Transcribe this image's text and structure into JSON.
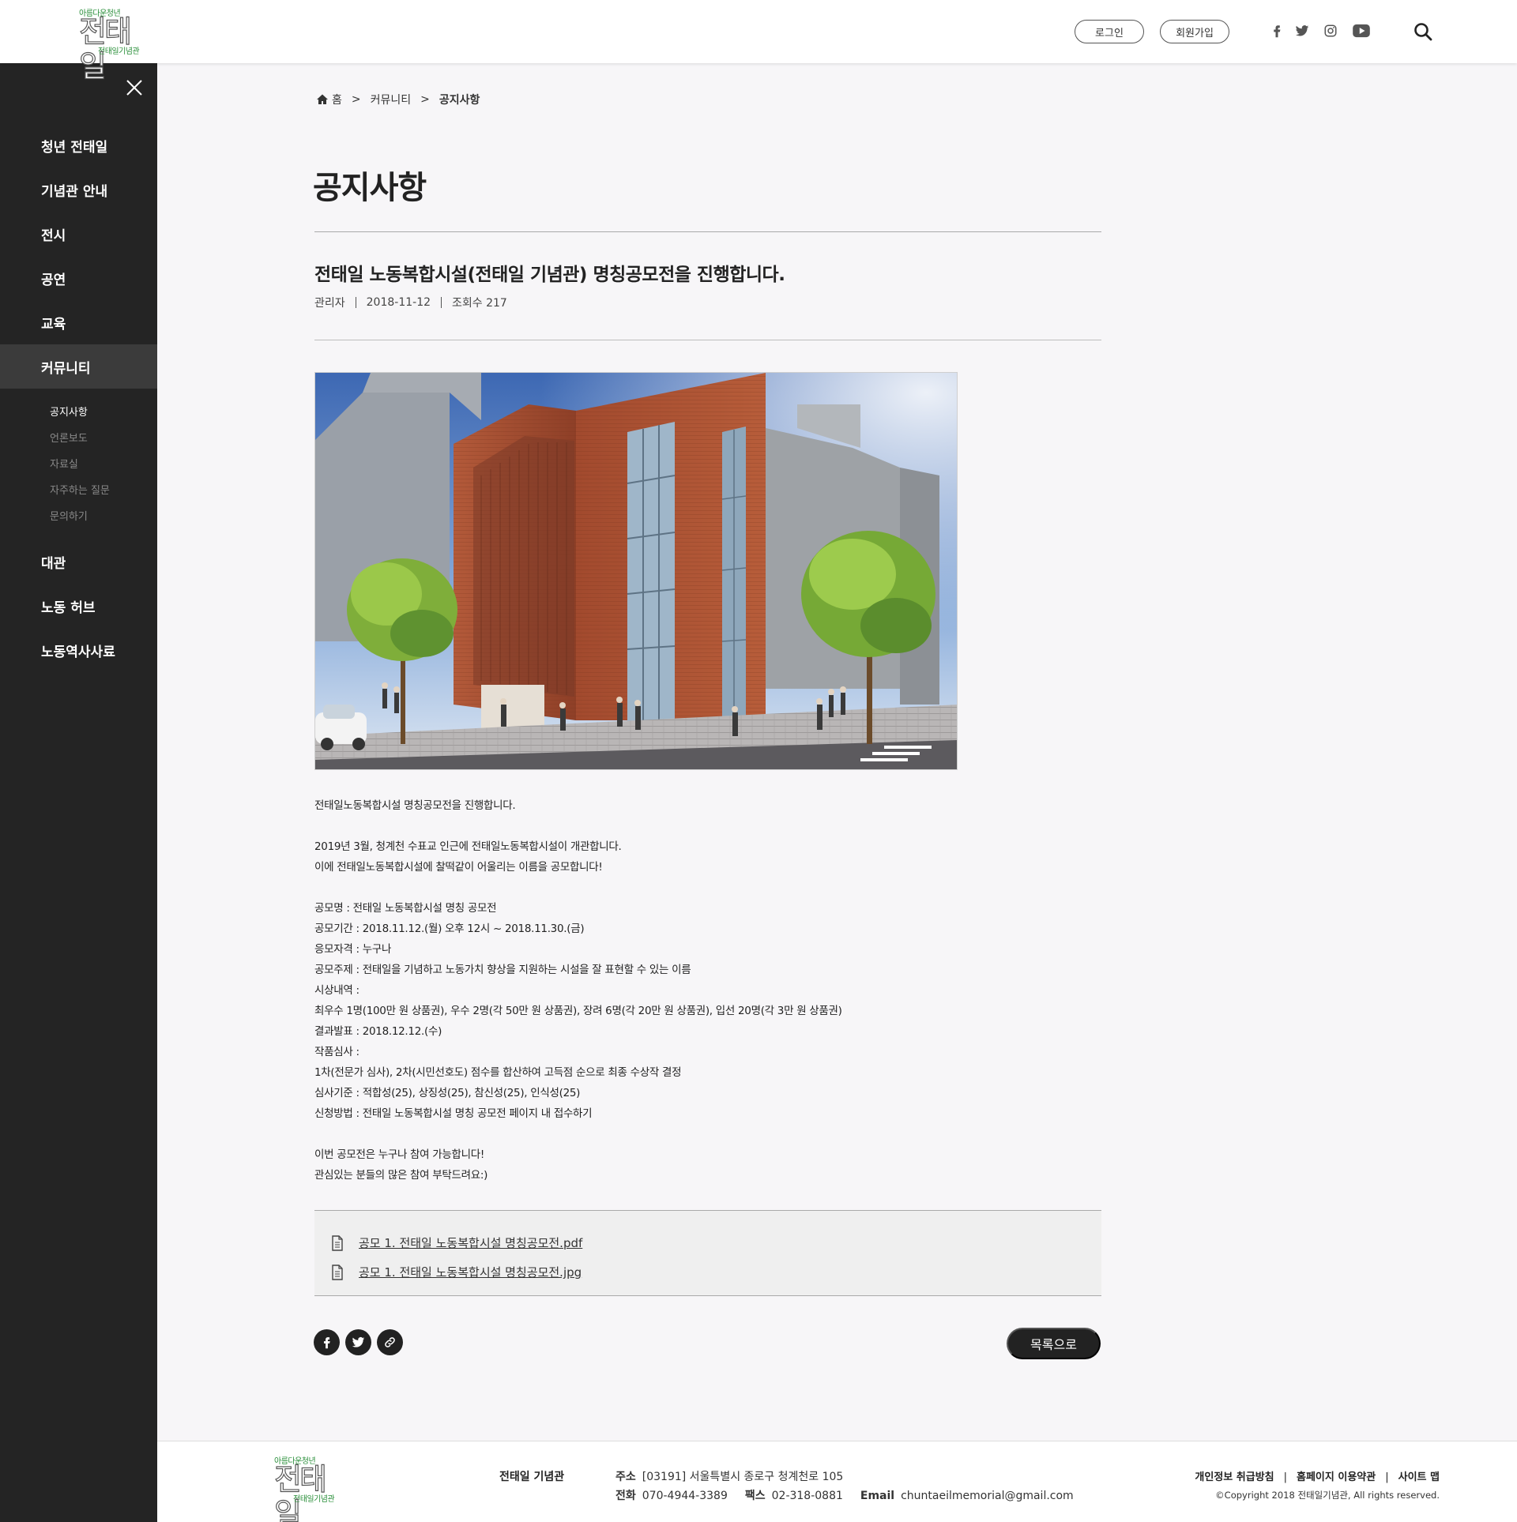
{
  "header": {
    "logo": {
      "top_text": "아름다운청년",
      "main_text": "전태일",
      "sub_text": "전태일기념관"
    },
    "login_label": "로그인",
    "join_label": "회원가입",
    "sns_icons": [
      "facebook-icon",
      "twitter-icon",
      "instagram-icon",
      "youtube-icon"
    ],
    "search_icon": "search-icon"
  },
  "sidebar": {
    "close_icon": "close-icon",
    "items": [
      {
        "label": "청년 전태일"
      },
      {
        "label": "기념관 안내"
      },
      {
        "label": "전시"
      },
      {
        "label": "공연"
      },
      {
        "label": "교육"
      },
      {
        "label": "커뮤니티",
        "active": true
      },
      {
        "label": "대관"
      },
      {
        "label": "노동 허브"
      },
      {
        "label": "노동역사사료"
      }
    ],
    "subitems": [
      {
        "label": "공지사항",
        "active": true
      },
      {
        "label": "언론보도"
      },
      {
        "label": "자료실"
      },
      {
        "label": "자주하는 질문"
      },
      {
        "label": "문의하기"
      }
    ]
  },
  "breadcrumb": {
    "home": "홈",
    "sep": ">",
    "section": "커뮤니티",
    "current": "공지사항"
  },
  "page_title": "공지사항",
  "post": {
    "title": "전태일 노동복합시설(전태일 기념관) 명칭공모전을 진행합니다.",
    "author": "관리자",
    "date": "2018-11-12",
    "views": "조회수 217",
    "body": [
      "전태일노동복합시설 명칭공모전을 진행합니다.",
      "",
      "2019년 3월, 청계천 수표교 인근에 전태일노동복합시설이 개관합니다.",
      "이에 전태일노동복합시설에 찰떡같이 어울리는 이름을 공모합니다!",
      "",
      "공모명 : 전태일 노동복합시설 명칭 공모전",
      "공모기간 : 2018.11.12.(월) 오후 12시 ~ 2018.11.30.(금)",
      "응모자격 : 누구나",
      "공모주제 : 전태일을 기념하고 노동가치 향상을 지원하는 시설을 잘 표현할 수 있는 이름",
      "시상내역 :",
      "최우수 1명(100만 원 상품권), 우수 2명(각 50만 원 상품권), 장려 6명(각 20만 원 상품권), 입선 20명(각 3만 원 상품권)",
      "결과발표 : 2018.12.12.(수)",
      "작품심사 :",
      "1차(전문가 심사), 2차(시민선호도) 점수를 합산하여 고득점 순으로 최종 수상작 결정",
      "심사기준 : 적합성(25), 상징성(25), 참신성(25), 인식성(25)",
      "신청방법 : 전태일 노동복합시설 명칭 공모전 페이지 내 접수하기",
      "",
      "이번 공모전은 누구나 참여 가능합니다!",
      "관심있는 분들의 많은 참여 부탁드려요:)"
    ],
    "attachments": [
      {
        "name": "공모 1. 전태일 노동복합시설 명칭공모전.pdf"
      },
      {
        "name": "공모 1. 전태일 노동복합시설 명칭공모전.jpg"
      }
    ],
    "list_button": "목록으로"
  },
  "footer": {
    "name": "전태일 기념관",
    "address_label": "주소",
    "address": "[03191] 서울특별시 종로구 청계천로 105",
    "tel_label": "전화",
    "tel": "070-4944-3389",
    "fax_label": "팩스",
    "fax": "02-318-0881",
    "email_label": "Email",
    "email": "chuntaeilmemorial@gmail.com",
    "links": [
      "개인정보 취급방침",
      "홈페이지 이용약관",
      "사이트 맵"
    ],
    "copyright": "©Copyright 2018 전태일기념관, All rights reserved."
  },
  "colors": {
    "sidebar_bg": "#242424",
    "sidebar_active": "#3b3b3b",
    "page_bg": "#f7f6f8",
    "logo_green": "#2a8f3a",
    "button_dark": "#222222"
  }
}
